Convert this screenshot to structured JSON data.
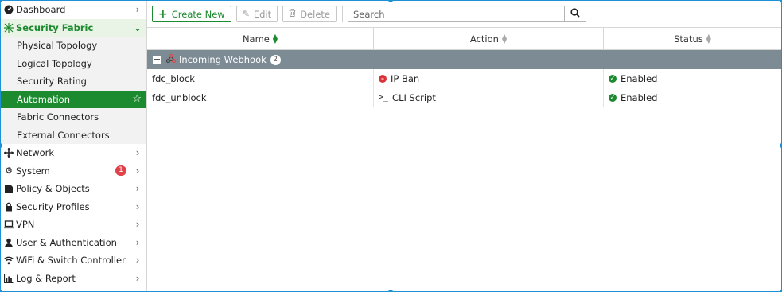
{
  "sidebar": {
    "items": [
      {
        "label": "Dashboard",
        "icon": "dashboard-icon"
      },
      {
        "label": "Security Fabric",
        "icon": "security-fabric-icon"
      },
      {
        "label": "Physical Topology"
      },
      {
        "label": "Logical Topology"
      },
      {
        "label": "Security Rating"
      },
      {
        "label": "Automation"
      },
      {
        "label": "Fabric Connectors"
      },
      {
        "label": "External Connectors"
      },
      {
        "label": "Network",
        "icon": "network-icon"
      },
      {
        "label": "System",
        "icon": "gear-icon",
        "badge": "1"
      },
      {
        "label": "Policy & Objects",
        "icon": "policy-icon"
      },
      {
        "label": "Security Profiles",
        "icon": "lock-icon"
      },
      {
        "label": "VPN",
        "icon": "laptop-icon"
      },
      {
        "label": "User & Authentication",
        "icon": "user-icon"
      },
      {
        "label": "WiFi & Switch Controller",
        "icon": "wifi-icon"
      },
      {
        "label": "Log & Report",
        "icon": "chart-icon"
      }
    ]
  },
  "toolbar": {
    "create_label": "Create New",
    "edit_label": "Edit",
    "delete_label": "Delete",
    "search_placeholder": "Search"
  },
  "table": {
    "columns": [
      "Name",
      "Action",
      "Status"
    ],
    "group": {
      "label": "Incoming Webhook",
      "count": "2"
    },
    "rows": [
      {
        "name": "fdc_block",
        "action": "IP Ban",
        "status": "Enabled"
      },
      {
        "name": "fdc_unblock",
        "action": "CLI Script",
        "status": "Enabled"
      }
    ]
  },
  "colors": {
    "accent": "#1c8a2e",
    "group_header": "#7d8b94",
    "badge": "#e0424a",
    "selection_border": "#1e90d6"
  }
}
